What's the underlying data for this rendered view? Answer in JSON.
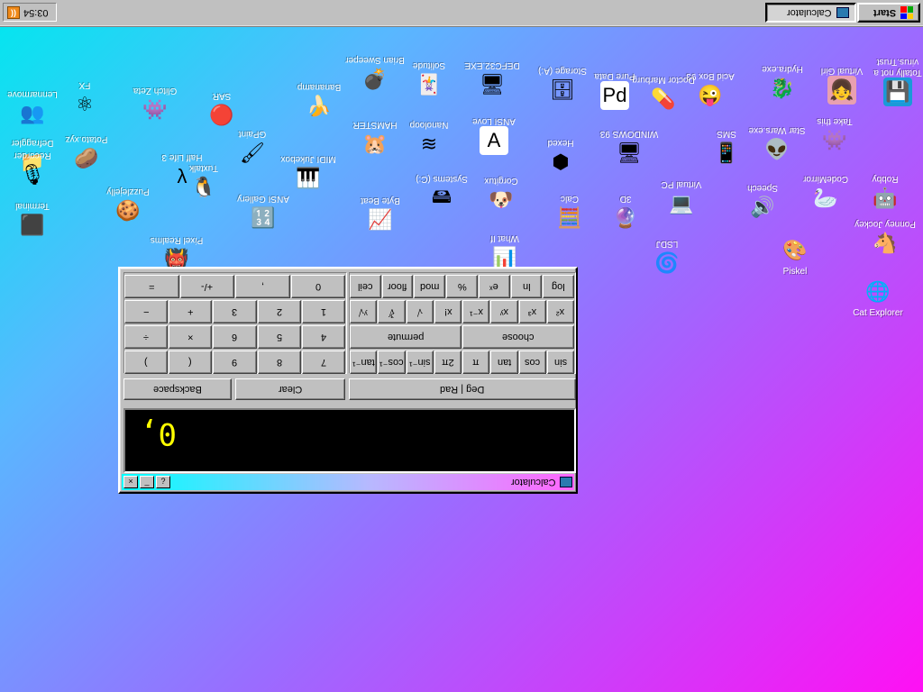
{
  "taskbar": {
    "clock": "03:54",
    "start_label": "Start",
    "task_calculator": "Calculator"
  },
  "desktop_icons": [
    {
      "label": "Totally not a virus.Trust",
      "glyph": "💾",
      "bg": "#1a9ad8",
      "rot": 180,
      "upright": false
    },
    {
      "label": "Virtual Girl",
      "glyph": "👧",
      "bg": "#e8a0b0",
      "rot": 180,
      "upright": false
    },
    {
      "label": "Hydra.exe",
      "glyph": "🐉",
      "bg": "transparent",
      "rot": 180,
      "upright": false
    },
    {
      "label": "Acid Box 93",
      "glyph": "😜",
      "bg": "transparent",
      "rot": 180,
      "upright": false
    },
    {
      "label": "Doctor Marburg",
      "glyph": "💊",
      "bg": "transparent",
      "rot": 180,
      "upright": false
    },
    {
      "label": "Pure Data",
      "glyph": "Pd",
      "bg": "#ffffff",
      "rot": 180,
      "upright": false
    },
    {
      "label": "Storage (A:)",
      "glyph": "🗄",
      "bg": "transparent",
      "rot": 180,
      "upright": false
    },
    {
      "label": "DEFC32.EXE",
      "glyph": "🖥",
      "bg": "transparent",
      "rot": 180,
      "upright": false
    },
    {
      "label": "Solitude",
      "glyph": "🃏",
      "bg": "transparent",
      "rot": 180,
      "upright": false
    },
    {
      "label": "Brian Sweeper",
      "glyph": "💣",
      "bg": "transparent",
      "rot": 180,
      "upright": false
    },
    {
      "label": "Bananamp",
      "glyph": "🍌",
      "bg": "transparent",
      "rot": 180,
      "upright": false
    },
    {
      "label": "SAR",
      "glyph": "🔴",
      "bg": "transparent",
      "rot": 180,
      "upright": false
    },
    {
      "label": "Glitch Zeta",
      "glyph": "👾",
      "bg": "transparent",
      "rot": 180,
      "upright": false
    },
    {
      "label": "FX",
      "glyph": "⚛",
      "bg": "transparent",
      "rot": 180,
      "upright": false
    },
    {
      "label": "Lennarmove",
      "glyph": "👥",
      "bg": "transparent",
      "rot": 180,
      "upright": false
    },
    {
      "label": "Defraggler",
      "glyph": "📁",
      "bg": "transparent",
      "rot": 180,
      "upright": false
    },
    {
      "label": "Take this",
      "glyph": "👾",
      "bg": "transparent",
      "rot": 180,
      "upright": false
    },
    {
      "label": "Star Wars.exe",
      "glyph": "👽",
      "bg": "transparent",
      "rot": 180,
      "upright": false
    },
    {
      "label": "SMS",
      "glyph": "📱",
      "bg": "transparent",
      "rot": 180,
      "upright": false
    },
    {
      "label": "WINDOWS 93",
      "glyph": "🖥",
      "bg": "transparent",
      "rot": 180,
      "upright": false
    },
    {
      "label": "Hexed",
      "glyph": "⬢",
      "bg": "transparent",
      "rot": 180,
      "upright": false
    },
    {
      "label": "ANSI Love",
      "glyph": "A",
      "bg": "#ffffff",
      "rot": 180,
      "upright": false
    },
    {
      "label": "Nanoloop",
      "glyph": "≋",
      "bg": "transparent",
      "rot": 180,
      "upright": false
    },
    {
      "label": "HAMSTER",
      "glyph": "🐹",
      "bg": "transparent",
      "rot": 180,
      "upright": false
    },
    {
      "label": "MIDI Jukebox",
      "glyph": "🎹",
      "bg": "transparent",
      "rot": 180,
      "upright": false
    },
    {
      "label": "GPaint",
      "glyph": "🖌",
      "bg": "transparent",
      "rot": 180,
      "upright": false
    },
    {
      "label": "Half Life 3",
      "glyph": "λ",
      "bg": "transparent",
      "rot": 180,
      "upright": false
    },
    {
      "label": "Potato.xyz",
      "glyph": "🥔",
      "bg": "transparent",
      "rot": 180,
      "upright": false
    },
    {
      "label": "Recorder",
      "glyph": "🎙",
      "bg": "transparent",
      "rot": 180,
      "upright": false
    },
    {
      "label": "Robby",
      "glyph": "🤖",
      "bg": "transparent",
      "rot": 180,
      "upright": false
    },
    {
      "label": "CodeMirror",
      "glyph": "🦢",
      "bg": "transparent",
      "rot": 180,
      "upright": false
    },
    {
      "label": "Speech",
      "glyph": "🔊",
      "bg": "transparent",
      "rot": 180,
      "upright": false
    },
    {
      "label": "Virtual PC",
      "glyph": "💻",
      "bg": "transparent",
      "rot": 180,
      "upright": false
    },
    {
      "label": "3D",
      "glyph": "🔮",
      "bg": "transparent",
      "rot": 180,
      "upright": false
    },
    {
      "label": "Calc",
      "glyph": "🧮",
      "bg": "transparent",
      "rot": 180,
      "upright": false
    },
    {
      "label": "Corgitux",
      "glyph": "🐶",
      "bg": "transparent",
      "rot": 180,
      "upright": false
    },
    {
      "label": "Systems (C:)",
      "glyph": "🖴",
      "bg": "transparent",
      "rot": 180,
      "upright": false
    },
    {
      "label": "Byte Beat",
      "glyph": "📈",
      "bg": "transparent",
      "rot": 180,
      "upright": false
    },
    {
      "label": "ANSI Gallery",
      "glyph": "🔢",
      "bg": "transparent",
      "rot": 180,
      "upright": false
    },
    {
      "label": "Tuxtalk",
      "glyph": "🐧",
      "bg": "transparent",
      "rot": 180,
      "upright": false
    },
    {
      "label": "Puzzlejelly",
      "glyph": "🍪",
      "bg": "transparent",
      "rot": 180,
      "upright": false
    },
    {
      "label": "Terminal",
      "glyph": "⬛",
      "bg": "transparent",
      "rot": 180,
      "upright": false
    },
    {
      "label": "Ponney Jockey",
      "glyph": "🐴",
      "bg": "transparent",
      "rot": 180,
      "upright": false
    },
    {
      "label": "LSDJ",
      "glyph": "🌀",
      "bg": "transparent",
      "rot": 180,
      "upright": false
    },
    {
      "label": "What If",
      "glyph": "📊",
      "bg": "transparent",
      "rot": 180,
      "upright": false
    },
    {
      "label": "Pixel Realms",
      "glyph": "👹",
      "bg": "transparent",
      "rot": 180,
      "upright": false
    },
    {
      "label": "Piskel",
      "glyph": "🎨",
      "bg": "transparent",
      "rot": 0,
      "upright": true
    },
    {
      "label": "Cat Explorer",
      "glyph": "🌐",
      "bg": "transparent",
      "rot": 0,
      "upright": true
    }
  ],
  "calculator": {
    "title": "Calculator",
    "display_value": "0,",
    "help_label": "?",
    "minimize_label": "_",
    "close_label": "×",
    "deg_rad_label": "Deg | Rad",
    "clear_label": "Clear",
    "backspace_label": "Backspace",
    "sci_rows": [
      [
        "sin",
        "cos",
        "tan",
        "π",
        "2π",
        "sin⁻¹",
        "cos⁻¹",
        "tan⁻¹"
      ],
      [
        "choose",
        "permute"
      ],
      [
        "x²",
        "x³",
        "xʸ",
        "x⁻¹",
        "x!",
        "√",
        "∛",
        "ʸ√"
      ],
      [
        "log",
        "ln",
        "eˣ",
        "%",
        "mod",
        "floor",
        "ceil"
      ]
    ],
    "num_rows": [
      [
        "7",
        "8",
        "9",
        "(",
        ")"
      ],
      [
        "4",
        "5",
        "6",
        "×",
        "÷"
      ],
      [
        "1",
        "2",
        "3",
        "+",
        "−"
      ],
      [
        "0",
        ",",
        "+/-",
        "="
      ]
    ]
  }
}
